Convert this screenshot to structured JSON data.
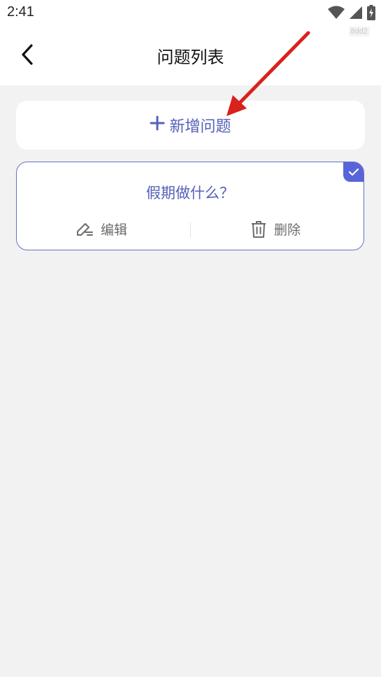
{
  "status_bar": {
    "time": "2:41",
    "tag": "8dd2"
  },
  "header": {
    "title": "问题列表"
  },
  "add_button": {
    "label": "新增问题"
  },
  "questions": [
    {
      "title": "假期做什么？",
      "edit_label": "编辑",
      "delete_label": "删除",
      "selected": true
    }
  ],
  "colors": {
    "accent": "#5560b8",
    "annotation_arrow": "#d9221c"
  }
}
